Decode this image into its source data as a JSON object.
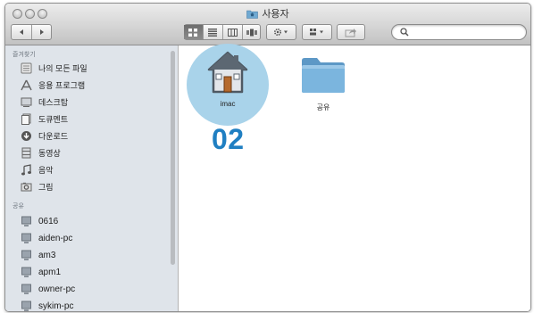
{
  "window": {
    "title": "사용자",
    "title_icon": "home-folder-icon"
  },
  "toolbar": {
    "nav": {
      "back_icon": "back-arrow-icon",
      "forward_icon": "forward-arrow-icon"
    },
    "view_modes": [
      {
        "name": "icon-view",
        "icon": "grid-icon",
        "active": true
      },
      {
        "name": "list-view",
        "icon": "list-icon",
        "active": false
      },
      {
        "name": "column-view",
        "icon": "columns-icon",
        "active": false
      },
      {
        "name": "coverflow-view",
        "icon": "coverflow-icon",
        "active": false
      }
    ],
    "action_icon": "gear-icon",
    "arrange_icon": "arrange-icon",
    "share_icon": "share-icon",
    "search": {
      "placeholder": "",
      "value": "",
      "icon": "search-icon"
    }
  },
  "sidebar": {
    "favorites_header": "즐겨찾기",
    "favorites": [
      {
        "label": "나의 모든 파일",
        "icon": "all-files-icon"
      },
      {
        "label": "응용 프로그램",
        "icon": "applications-icon"
      },
      {
        "label": "데스크탑",
        "icon": "desktop-icon"
      },
      {
        "label": "도큐멘트",
        "icon": "documents-icon"
      },
      {
        "label": "다운로드",
        "icon": "downloads-icon"
      },
      {
        "label": "동영상",
        "icon": "movies-icon"
      },
      {
        "label": "음악",
        "icon": "music-icon"
      },
      {
        "label": "그림",
        "icon": "pictures-icon"
      }
    ],
    "shared_header": "공유",
    "shared": [
      {
        "label": "0616",
        "icon": "computer-icon"
      },
      {
        "label": "aiden-pc",
        "icon": "computer-icon"
      },
      {
        "label": "am3",
        "icon": "computer-icon"
      },
      {
        "label": "apm1",
        "icon": "computer-icon"
      },
      {
        "label": "owner-pc",
        "icon": "computer-icon"
      },
      {
        "label": "sykim-pc",
        "icon": "computer-icon"
      }
    ]
  },
  "content": {
    "items": [
      {
        "label": "imac",
        "icon": "home-folder-icon",
        "highlighted": true
      },
      {
        "label": "공유",
        "icon": "folder-icon",
        "highlighted": false
      }
    ],
    "step_label": "02"
  },
  "colors": {
    "highlight_circle": "#a9d3ea",
    "step_label": "#1f7fc2",
    "folder_blue": "#6fa9d2",
    "sidebar_bg": "#dfe4ea"
  }
}
